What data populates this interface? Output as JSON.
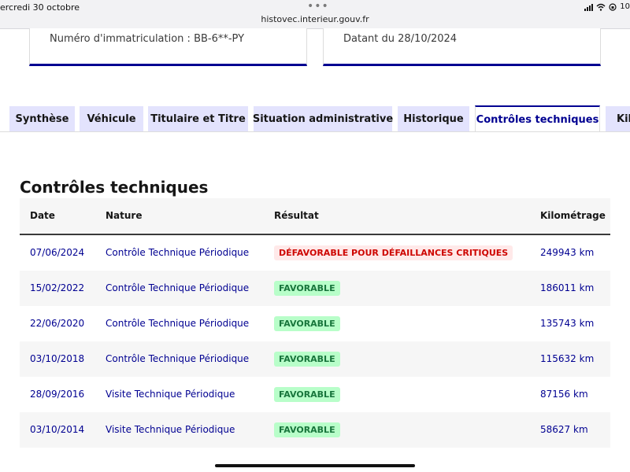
{
  "statusbar": {
    "date": "ercredi 30 octobre",
    "dots": "•••",
    "url": "histovec.interieur.gouv.fr",
    "right_text": "10"
  },
  "cards": {
    "registration": "Numéro d'immatriculation : BB-6**-PY",
    "date": "Datant du 28/10/2024"
  },
  "tabs": [
    {
      "label": "Synthèse",
      "active": false
    },
    {
      "label": "Véhicule",
      "active": false
    },
    {
      "label": "Titulaire et Titre",
      "active": false
    },
    {
      "label": "Situation administrative",
      "active": false
    },
    {
      "label": "Historique",
      "active": false
    },
    {
      "label": "Contrôles techniques",
      "active": true
    },
    {
      "label": "Kilo",
      "active": false
    }
  ],
  "section": {
    "title": "Contrôles techniques"
  },
  "table": {
    "headers": {
      "date": "Date",
      "nature": "Nature",
      "result": "Résultat",
      "km": "Kilométrage"
    },
    "rows": [
      {
        "date": "07/06/2024",
        "nature": "Contrôle Technique Périodique",
        "result": "DÉFAVORABLE POUR DÉFAILLANCES CRITIQUES",
        "status": "fail",
        "km": "249943 km"
      },
      {
        "date": "15/02/2022",
        "nature": "Contrôle Technique Périodique",
        "result": "FAVORABLE",
        "status": "ok",
        "km": "186011 km"
      },
      {
        "date": "22/06/2020",
        "nature": "Contrôle Technique Périodique",
        "result": "FAVORABLE",
        "status": "ok",
        "km": "135743 km"
      },
      {
        "date": "03/10/2018",
        "nature": "Contrôle Technique Périodique",
        "result": "FAVORABLE",
        "status": "ok",
        "km": "115632 km"
      },
      {
        "date": "28/09/2016",
        "nature": "Visite Technique Périodique",
        "result": "FAVORABLE",
        "status": "ok",
        "km": "87156 km"
      },
      {
        "date": "03/10/2014",
        "nature": "Visite Technique Périodique",
        "result": "FAVORABLE",
        "status": "ok",
        "km": "58627 km"
      }
    ]
  },
  "colors": {
    "primary_blue": "#000091",
    "tab_background": "#e3e3fd",
    "favorable_green": "#18753c",
    "favorable_background": "#b8fec9",
    "defavorable_red": "#ce0500",
    "defavorable_background": "#ffe9e9"
  },
  "icons": {
    "signal": "signal-icon",
    "wifi": "wifi-icon",
    "rotation_lock": "rotation-lock-icon",
    "more": "more-dots-icon"
  }
}
